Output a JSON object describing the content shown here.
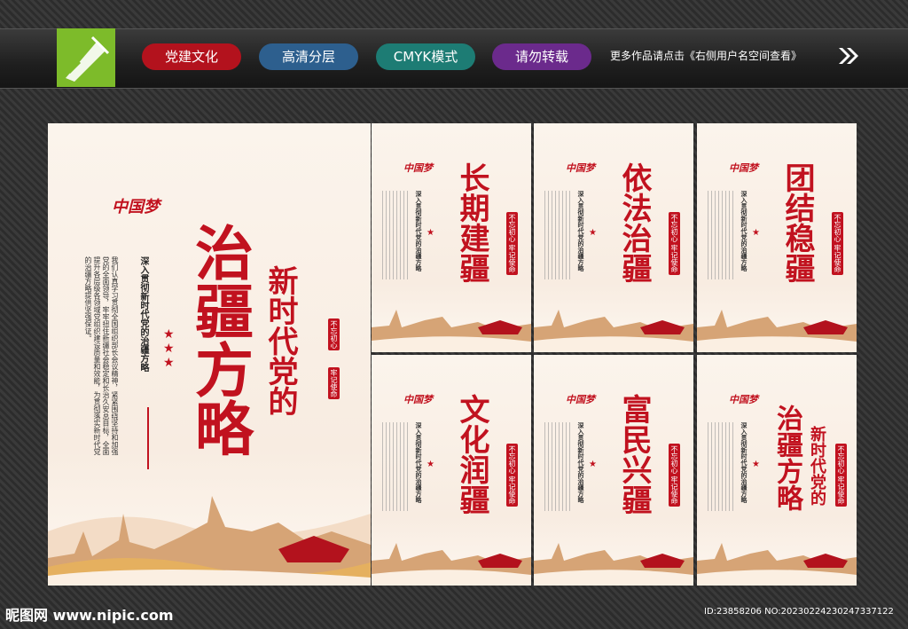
{
  "toolbar": {
    "tags": [
      {
        "label": "党建文化",
        "color": "#b3121d"
      },
      {
        "label": "高清分层",
        "color": "#2d5f8e"
      },
      {
        "label": "CMYK模式",
        "color": "#1d7c74"
      },
      {
        "label": "请勿转载",
        "color": "#6b2a8c"
      }
    ],
    "more_text": "更多作品请点击《右侧用户名空间查看》"
  },
  "main_poster": {
    "logo_text": "中国梦",
    "title": "治疆方略",
    "subtitle": "新时代党的",
    "heading": "深入贯彻新时代党的治疆方略",
    "body": "我们认真学习贯彻全国组织部长会议精神，紧紧围绕坚持和加强党的全面领导，牢牢扭住新疆社会稳定和长治久安总目标，全面提升各层级各领域党组织建设质量和效能，为贯彻落实新时代党的治疆方略提供坚强保证。",
    "seal1": "不忘初心",
    "seal2": "牢记使命"
  },
  "small_posters": [
    {
      "title": "长期建疆",
      "heading": "深入贯彻新时代党的治疆方略"
    },
    {
      "title": "依法治疆",
      "heading": "深入贯彻新时代党的治疆方略"
    },
    {
      "title": "团结稳疆",
      "heading": "深入贯彻新时代党的治疆方略"
    },
    {
      "title": "文化润疆",
      "heading": "深入贯彻新时代党的治疆方略"
    },
    {
      "title": "富民兴疆",
      "heading": "深入贯彻新时代党的治疆方略"
    },
    {
      "title": "治疆方略",
      "subtitle": "新时代党的",
      "heading": "深入贯彻新时代党的治疆方略"
    }
  ],
  "small_seal": "不忘初心 牢记使命",
  "footer": {
    "site": "昵图网 www.nipic.com",
    "id": "ID:23858206 NO:20230224230247337122"
  }
}
